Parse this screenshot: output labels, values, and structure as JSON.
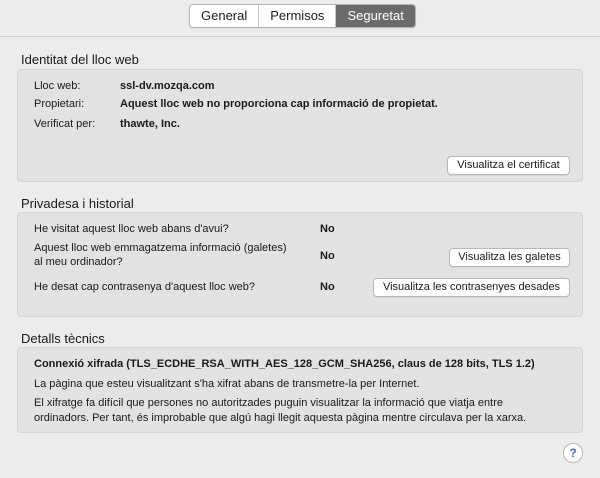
{
  "tabs": [
    {
      "label": "General",
      "active": false
    },
    {
      "label": "Permisos",
      "active": false
    },
    {
      "label": "Seguretat",
      "active": true
    }
  ],
  "identity": {
    "title": "Identitat del lloc web",
    "website_label": "Lloc web:",
    "website_value": "ssl-dv.mozqa.com",
    "owner_label": "Propietari:",
    "owner_value": "Aquest lloc web no proporciona cap informació de propietat.",
    "verified_label": "Verificat per:",
    "verified_value": "thawte, Inc.",
    "view_cert_button": "Visualitza el certificat"
  },
  "privacy": {
    "title": "Privadesa i historial",
    "visited_q": "He visitat aquest lloc web abans d'avui?",
    "visited_a": "No",
    "cookies_q_line1": "Aquest lloc web emmagatzema informació (galetes)",
    "cookies_q_line2": "al meu ordinador?",
    "cookies_a": "No",
    "cookies_button": "Visualitza les galetes",
    "passwords_q": "He desat cap contrasenya d'aquest lloc web?",
    "passwords_a": "No",
    "passwords_button": "Visualitza les contrasenyes desades"
  },
  "technical": {
    "title": "Detalls tècnics",
    "connection": "Connexió xifrada (TLS_ECDHE_RSA_WITH_AES_128_GCM_SHA256, claus de 128 bits, TLS 1.2)",
    "para1": "La pàgina que esteu visualitzant s'ha xifrat abans de transmetre-la per Internet.",
    "para2_line1": "El xifratge fa difícil que persones no autoritzades puguin visualitzar la informació que viatja entre",
    "para2_line2": "ordinadors. Per tant, és improbable que algú hagi llegit aquesta pàgina mentre circulava per la xarxa."
  },
  "help": {
    "glyph": "?"
  },
  "colors": {
    "active_tab": "#6b6b6b",
    "box_bg": "#e2e2e2",
    "help_glyph": "#3a6fd8"
  }
}
